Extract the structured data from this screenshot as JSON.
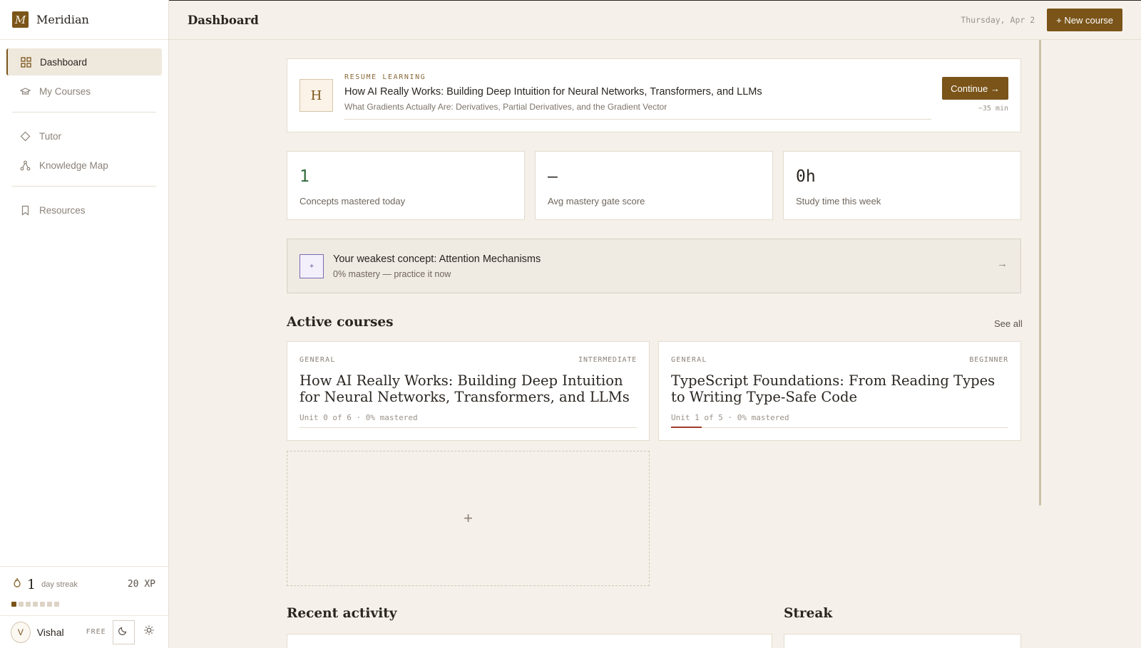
{
  "app": {
    "logo_letter": "M",
    "name": "Meridian"
  },
  "sidebar": {
    "items": [
      {
        "label": "Dashboard",
        "icon": "grid-icon",
        "active": true
      },
      {
        "label": "My Courses",
        "icon": "graduation-icon"
      },
      {
        "label": "Tutor",
        "icon": "diamond-icon"
      },
      {
        "label": "Knowledge Map",
        "icon": "graph-icon"
      },
      {
        "label": "Resources",
        "icon": "bookmark-icon"
      }
    ],
    "streak": {
      "count": "1",
      "label": "day streak",
      "xp": "20 XP",
      "active_days": 1,
      "total_days": 7
    },
    "user": {
      "initial": "V",
      "name": "Vishal",
      "plan": "FREE"
    }
  },
  "topbar": {
    "title": "Dashboard",
    "date": "Thursday, Apr 2",
    "new_course_label": "+ New course"
  },
  "resume": {
    "letter": "H",
    "kicker": "RESUME LEARNING",
    "title": "How AI Really Works: Building Deep Intuition for Neural Networks, Transformers, and LLMs",
    "subtitle": "What Gradients Actually Are: Derivatives, Partial Derivatives, and the Gradient Vector",
    "continue_label": "Continue →",
    "eta": "~35 min"
  },
  "stats": [
    {
      "value": "1",
      "label": "Concepts mastered today",
      "color": "#2f6b3a"
    },
    {
      "value": "—",
      "label": "Avg mastery gate score",
      "color": "#2a2520"
    },
    {
      "value": "0h",
      "label": "Study time this week",
      "color": "#2a2520"
    }
  ],
  "weakest": {
    "icon_glyph": "+",
    "title": "Your weakest concept: Attention Mechanisms",
    "subtitle": "0% mastery — practice it now",
    "arrow": "→"
  },
  "active_courses": {
    "heading": "Active courses",
    "see_all": "See all",
    "courses": [
      {
        "category": "GENERAL",
        "level": "INTERMEDIATE",
        "title": "How AI Really Works: Building Deep Intuition for Neural Networks, Transformers, and LLMs",
        "meta": "Unit 0 of 6 · 0% mastered",
        "progress": 0
      },
      {
        "category": "GENERAL",
        "level": "BEGINNER",
        "title": "TypeScript Foundations: From Reading Types to Writing Type-Safe Code",
        "meta": "Unit 1 of 5 · 0% mastered",
        "progress": 0.09
      }
    ],
    "add_glyph": "+"
  },
  "recent_activity": {
    "heading": "Recent activity"
  },
  "streak_section": {
    "heading": "Streak"
  },
  "colors": {
    "accent": "#7a5419",
    "background": "#f5f1ea",
    "progress": "#a33a2a"
  }
}
